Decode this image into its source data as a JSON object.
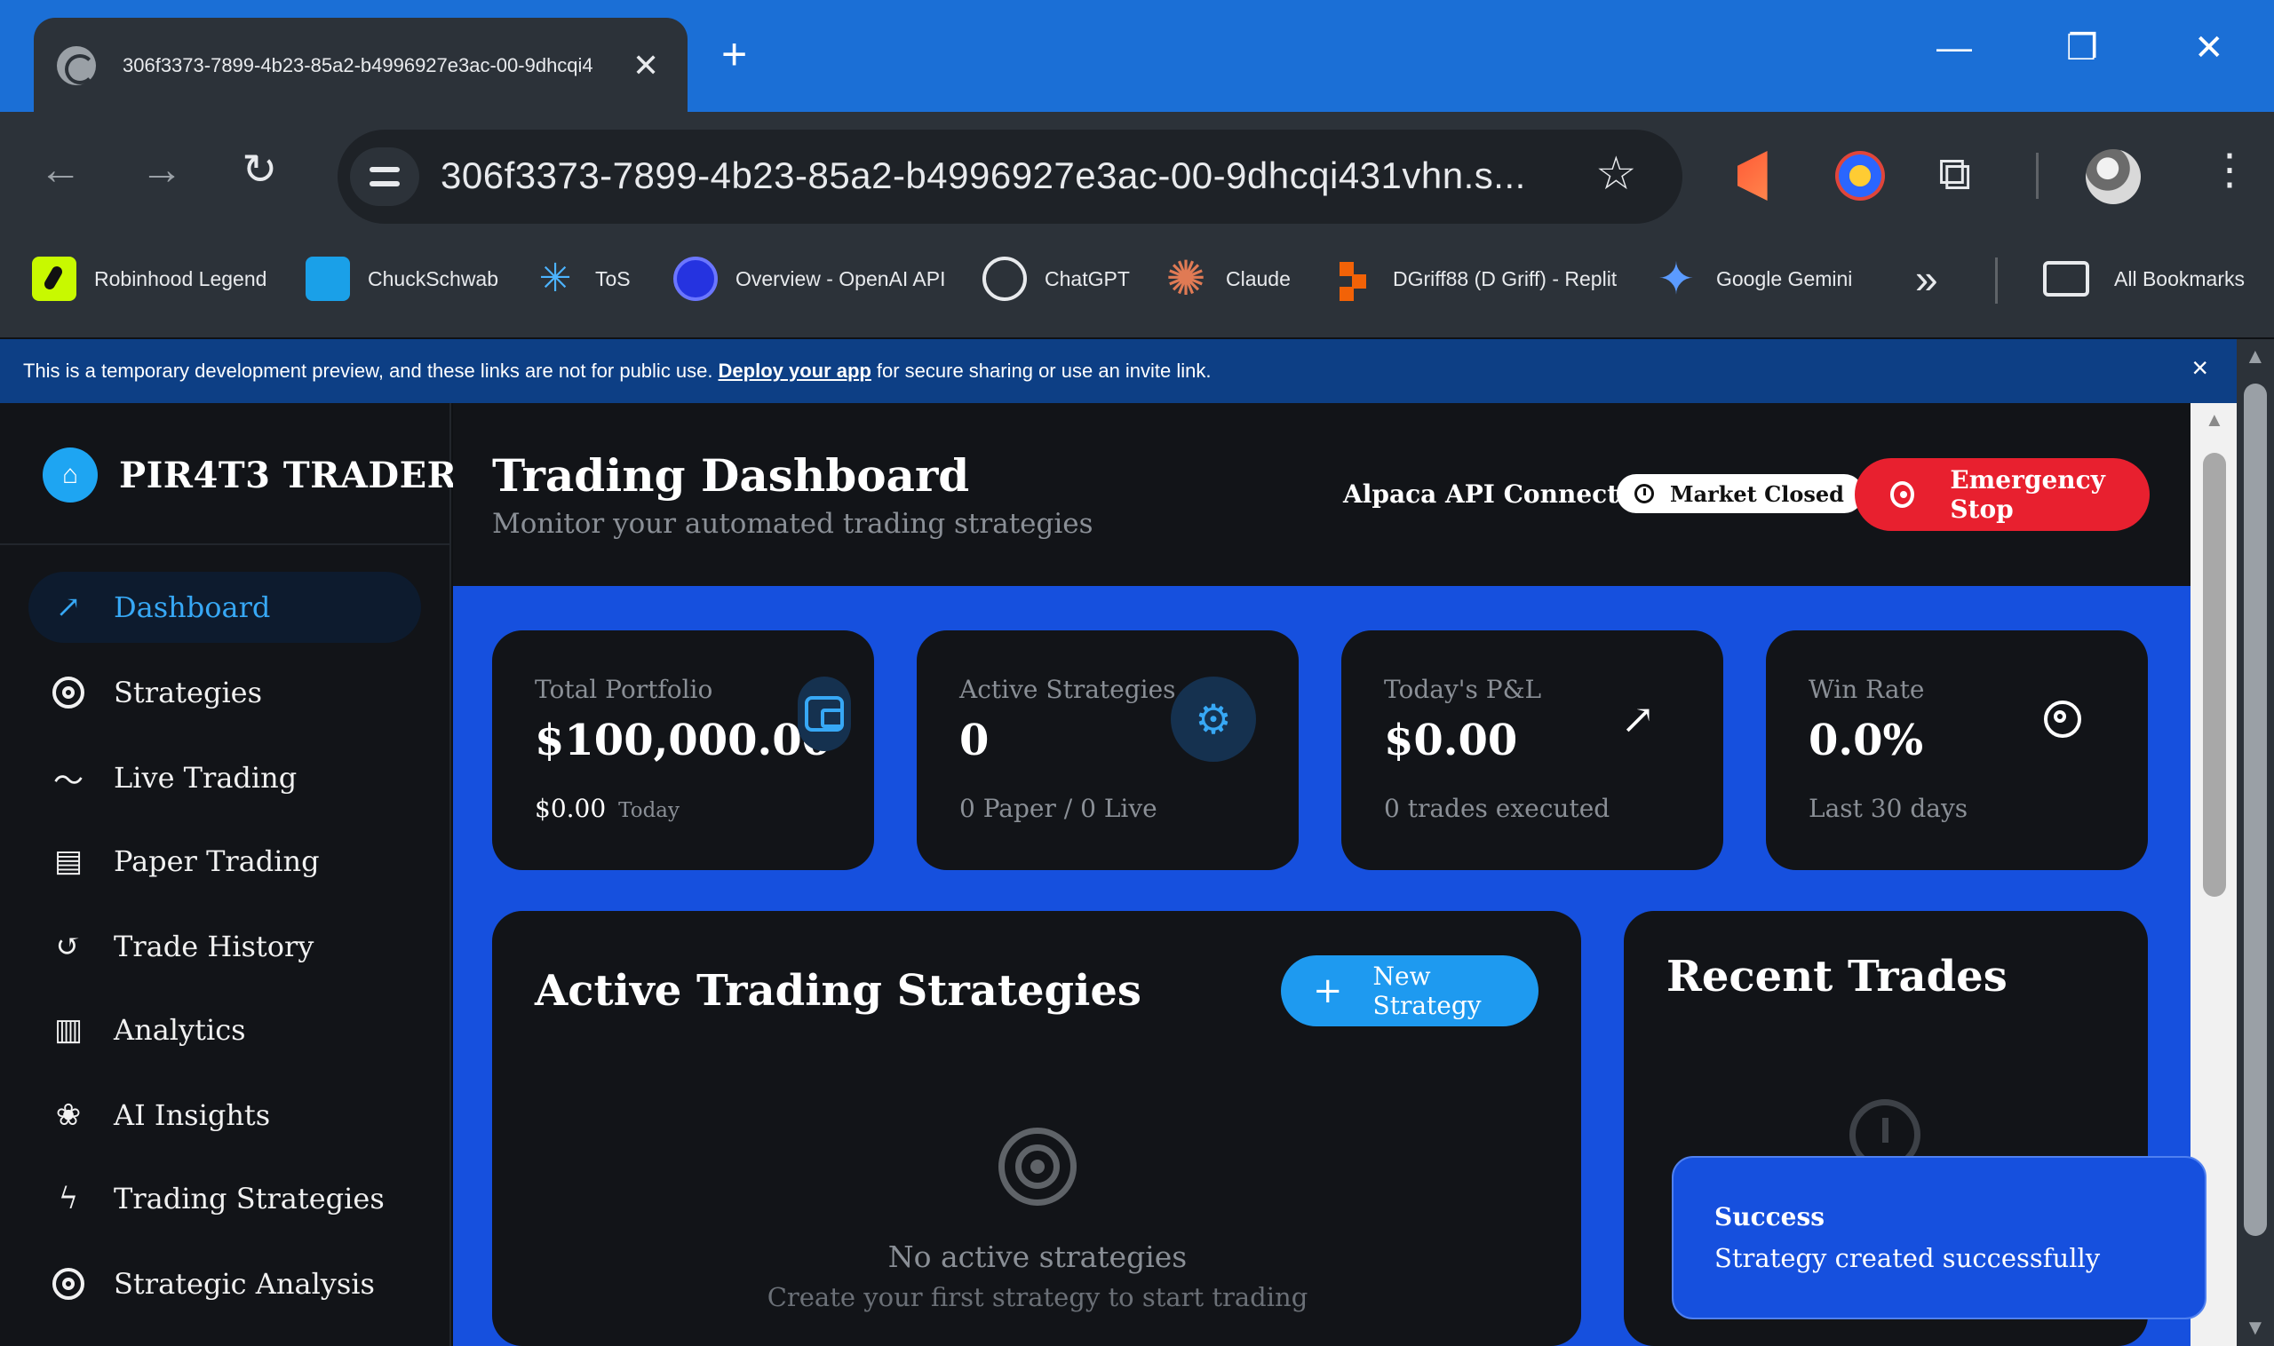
{
  "browser": {
    "tab_title": "306f3373-7899-4b23-85a2-b4996927e3ac-00-9dhcqi4",
    "url": "306f3373-7899-4b23-85a2-b4996927e3ac-00-9dhcqi431vhn.s...",
    "bookmarks": [
      {
        "label": "Robinhood Legend",
        "icon": "robinhood-icon"
      },
      {
        "label": "ChuckSchwab",
        "icon": "schwab-icon"
      },
      {
        "label": "ToS",
        "icon": "tos-icon"
      },
      {
        "label": "Overview - OpenAI API",
        "icon": "openai-icon"
      },
      {
        "label": "ChatGPT",
        "icon": "chatgpt-icon"
      },
      {
        "label": "Claude",
        "icon": "claude-icon"
      },
      {
        "label": "DGriff88 (D Griff) - Replit",
        "icon": "replit-icon"
      },
      {
        "label": "Google Gemini",
        "icon": "gemini-icon"
      }
    ],
    "all_bookmarks": "All Bookmarks"
  },
  "notice": {
    "before": "This is a temporary development preview, and these links are not for public use.",
    "link": "Deploy your app",
    "after": "for secure sharing or use an invite link."
  },
  "app": {
    "brand": "PIR4T3 TRADER",
    "nav": [
      {
        "label": "Dashboard",
        "icon": "trending-up-icon",
        "active": true
      },
      {
        "label": "Strategies",
        "icon": "target-icon"
      },
      {
        "label": "Live Trading",
        "icon": "activity-icon"
      },
      {
        "label": "Paper Trading",
        "icon": "file-icon"
      },
      {
        "label": "Trade History",
        "icon": "history-icon"
      },
      {
        "label": "Analytics",
        "icon": "bar-chart-icon"
      },
      {
        "label": "AI Insights",
        "icon": "brain-icon"
      },
      {
        "label": "Trading Strategies",
        "icon": "zap-icon"
      },
      {
        "label": "Strategic Analysis",
        "icon": "target-icon"
      }
    ]
  },
  "header": {
    "title": "Trading Dashboard",
    "subtitle": "Monitor your automated trading strategies",
    "api_status": "Alpaca API Connected",
    "market_status": "Market Closed",
    "emergency_stop": "Emergency Stop"
  },
  "stats": [
    {
      "label": "Total Portfolio",
      "value": "$100,000.00",
      "foot_value": "$0.00",
      "foot": "Today",
      "icon": "wallet-icon"
    },
    {
      "label": "Active Strategies",
      "value": "0",
      "foot": "0 Paper / 0 Live",
      "icon": "gear-icon"
    },
    {
      "label": "Today's P&L",
      "value": "$0.00",
      "foot": "0 trades executed",
      "icon": "trending-up-icon"
    },
    {
      "label": "Win Rate",
      "value": "0.0%",
      "foot": "Last 30 days",
      "icon": "target-icon"
    }
  ],
  "strategies_panel": {
    "title": "Active Trading Strategies",
    "new_button": "New Strategy",
    "empty_title": "No active strategies",
    "empty_sub": "Create your first strategy to start trading"
  },
  "trades_panel": {
    "title": "Recent Trades"
  },
  "toast": {
    "title": "Success",
    "message": "Strategy created successfully"
  },
  "colors": {
    "accent": "#1e9af0",
    "danger": "#e8202f",
    "content_bg": "#1650de",
    "chrome_blue": "#1b6fd6"
  }
}
